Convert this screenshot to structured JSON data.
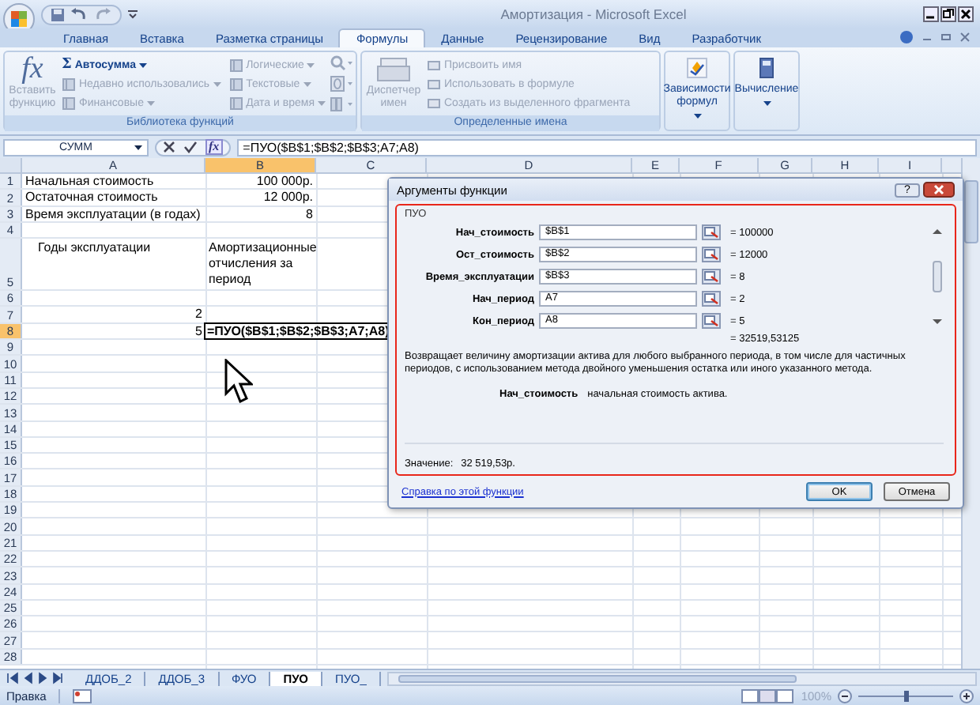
{
  "window": {
    "title": "Амортизация - Microsoft Excel"
  },
  "ribbon_tabs": [
    {
      "label": "Главная",
      "selected": false
    },
    {
      "label": "Вставка",
      "selected": false
    },
    {
      "label": "Разметка страницы",
      "selected": false
    },
    {
      "label": "Формулы",
      "selected": true
    },
    {
      "label": "Данные",
      "selected": false
    },
    {
      "label": "Рецензирование",
      "selected": false
    },
    {
      "label": "Вид",
      "selected": false
    },
    {
      "label": "Разработчик",
      "selected": false
    }
  ],
  "function_library": {
    "title": "Библиотека функций",
    "insert_function": {
      "symbol": "fx",
      "label": "Вставить функцию",
      "disabled": true
    },
    "items": [
      {
        "kind": "sum",
        "symbol": "Σ",
        "label": "Автосумма",
        "disabled": false
      },
      {
        "kind": "category",
        "label": "Недавно использовались",
        "disabled": true
      },
      {
        "kind": "category",
        "label": "Финансовые",
        "disabled": true
      },
      {
        "kind": "category",
        "label": "Логические",
        "disabled": true
      },
      {
        "kind": "category",
        "label": "Текстовые",
        "disabled": true
      },
      {
        "kind": "category",
        "label": "Дата и время",
        "disabled": true
      }
    ]
  },
  "defined_names": {
    "title": "Определенные имена",
    "name_manager": {
      "label": "Диспетчер имен",
      "disabled": true
    },
    "items": [
      {
        "label": "Присвоить имя",
        "disabled": true
      },
      {
        "label": "Использовать в формуле",
        "disabled": true
      },
      {
        "label": "Создать из выделенного фрагмента",
        "disabled": true
      }
    ]
  },
  "formula_auditing": {
    "label": "Зависимости формул"
  },
  "calculation": {
    "label": "Вычисление"
  },
  "formula_bar": {
    "name_box": "СУММ",
    "fx_button": "fx",
    "formula": "=ПУО($B$1;$B$2;$B$3;A7;A8)"
  },
  "sheet": {
    "columns": [
      {
        "label": "A",
        "selected": false
      },
      {
        "label": "B",
        "selected": true
      },
      {
        "label": "C",
        "selected": false
      },
      {
        "label": "D",
        "selected": false
      },
      {
        "label": "E",
        "selected": false
      },
      {
        "label": "F",
        "selected": false
      },
      {
        "label": "G",
        "selected": false
      },
      {
        "label": "H",
        "selected": false
      },
      {
        "label": "I",
        "selected": false
      }
    ],
    "rows": [
      {
        "number": "1",
        "selected": false,
        "a": {
          "text": "Начальная стоимость",
          "kind": "text"
        },
        "b": {
          "text": "100 000р.",
          "kind": "number"
        }
      },
      {
        "number": "2",
        "selected": false,
        "a": {
          "text": "Остаточная стоимость",
          "kind": "text"
        },
        "b": {
          "text": "12 000р.",
          "kind": "number"
        }
      },
      {
        "number": "3",
        "selected": false,
        "a": {
          "text": "Время эксплуатации (в годах)",
          "kind": "text"
        },
        "b": {
          "text": "8",
          "kind": "number"
        }
      },
      {
        "number": "4",
        "selected": false
      },
      {
        "number": "5",
        "selected": false,
        "a": {
          "text": "Годы эксплуатации",
          "kind": "heading"
        },
        "b": {
          "text": "Амортизационные отчисления за период",
          "kind": "heading"
        }
      },
      {
        "number": "6",
        "selected": false
      },
      {
        "number": "7",
        "selected": false,
        "a": {
          "text": "2",
          "kind": "number"
        }
      },
      {
        "number": "8",
        "selected": true,
        "a": {
          "text": "5",
          "kind": "number"
        },
        "b": {
          "text": "=ПУО($B$1;$B$2;$B$3;A7;A8)",
          "kind": "editing"
        }
      },
      {
        "number": "9",
        "selected": false
      },
      {
        "number": "10",
        "selected": false
      },
      {
        "number": "11",
        "selected": false
      },
      {
        "number": "12",
        "selected": false
      },
      {
        "number": "13",
        "selected": false
      },
      {
        "number": "14",
        "selected": false
      },
      {
        "number": "15",
        "selected": false
      },
      {
        "number": "16",
        "selected": false
      },
      {
        "number": "17",
        "selected": false
      },
      {
        "number": "18",
        "selected": false
      },
      {
        "number": "19",
        "selected": false
      },
      {
        "number": "20",
        "selected": false
      },
      {
        "number": "21",
        "selected": false
      },
      {
        "number": "22",
        "selected": false
      },
      {
        "number": "23",
        "selected": false
      },
      {
        "number": "24",
        "selected": false
      },
      {
        "number": "25",
        "selected": false
      },
      {
        "number": "26",
        "selected": false
      },
      {
        "number": "27",
        "selected": false
      },
      {
        "number": "28",
        "selected": false
      }
    ]
  },
  "dialog": {
    "title": "Аргументы функции",
    "help_button": "?",
    "function": "ПУО",
    "arguments": [
      {
        "label": "Нач_стоимость",
        "value": "$B$1",
        "result": "= 100000"
      },
      {
        "label": "Ост_стоимость",
        "value": "$B$2",
        "result": "= 12000"
      },
      {
        "label": "Время_эксплуатации",
        "value": "$B$3",
        "result": "= 8"
      },
      {
        "label": "Нач_период",
        "value": "A7",
        "result": "= 2"
      },
      {
        "label": "Кон_период",
        "value": "A8",
        "result": "= 5"
      }
    ],
    "result": "= 32519,53125",
    "description": "Возвращает величину амортизации актива для любого выбранного периода, в том числе для частичных периодов, с использованием метода двойного уменьшения остатка или иного указанного метода.",
    "argument_help": {
      "name": "Нач_стоимость",
      "text": "начальная стоимость актива."
    },
    "value_label": "Значение:",
    "value": "32 519,53р.",
    "help_link": "Справка по этой функции",
    "buttons": [
      "OK",
      "Отмена"
    ]
  },
  "sheet_tabs": [
    {
      "label": "ДДОБ_2",
      "selected": false
    },
    {
      "label": "ДДОБ_3",
      "selected": false
    },
    {
      "label": "ФУО",
      "selected": false
    },
    {
      "label": "ПУО",
      "selected": true
    },
    {
      "label": "ПУО_",
      "selected": false
    }
  ],
  "status_bar": {
    "mode": "Правка",
    "zoom": "100%",
    "zoom_slider": {
      "level": 0.5
    }
  }
}
